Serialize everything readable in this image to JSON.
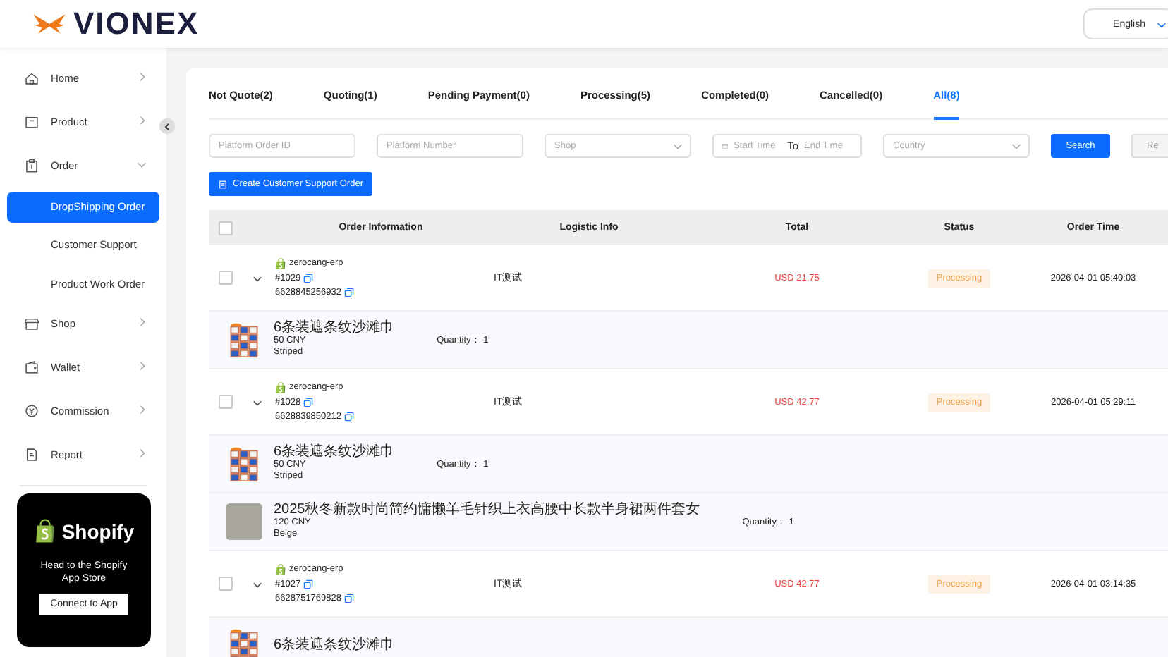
{
  "header": {
    "logo_text": "VIONEX",
    "language": "English"
  },
  "sidebar": {
    "items": [
      {
        "label": "Home",
        "expanded": false
      },
      {
        "label": "Product",
        "expanded": false
      },
      {
        "label": "Order",
        "expanded": true,
        "children": [
          {
            "label": "DropShipping Order",
            "selected": true
          },
          {
            "label": "Customer Support",
            "selected": false
          },
          {
            "label": "Product Work Order",
            "selected": false
          }
        ]
      },
      {
        "label": "Shop",
        "expanded": false
      },
      {
        "label": "Wallet",
        "expanded": false
      },
      {
        "label": "Commission",
        "expanded": false
      },
      {
        "label": "Report",
        "expanded": false
      }
    ]
  },
  "promo": {
    "brand": "Shopify",
    "text": "Head to the Shopify App Store",
    "button": "Connect to App"
  },
  "tabs": [
    {
      "label": "Not Quote(2)",
      "selected": false
    },
    {
      "label": "Quoting(1)",
      "selected": false
    },
    {
      "label": "Pending Payment(0)",
      "selected": false
    },
    {
      "label": "Processing(5)",
      "selected": false
    },
    {
      "label": "Completed(0)",
      "selected": false
    },
    {
      "label": "Cancelled(0)",
      "selected": false
    },
    {
      "label": "All(8)",
      "selected": true
    }
  ],
  "filters": {
    "platform_order_id": {
      "placeholder": "Platform Order ID"
    },
    "platform_number": {
      "placeholder": "Platform Number"
    },
    "shop": {
      "placeholder": "Shop"
    },
    "start_time": {
      "placeholder": "Start Time"
    },
    "date_separator": "To",
    "end_time": {
      "placeholder": "End Time"
    },
    "country": {
      "placeholder": "Country"
    },
    "search_button": "Search",
    "reset_button": "Re"
  },
  "create_button": "Create Customer Support Order",
  "table": {
    "columns": [
      "Order Information",
      "Logistic Info",
      "Total",
      "Status",
      "Order Time"
    ],
    "select_all": false,
    "orders": [
      {
        "checked": false,
        "expanded": true,
        "shop": "zerocang-erp",
        "order_no": "#1029",
        "platform_no": "6628845256932",
        "logistic": "IT测试",
        "total": "USD 21.75",
        "status": "Processing",
        "time": "2026-04-01 05:40:03",
        "items": [
          {
            "kind": "towel",
            "name": "6条装遮条纹沙滩巾",
            "price": "50 CNY",
            "variant": "Striped",
            "quantity_label": "Quantity：",
            "quantity": "1"
          }
        ]
      },
      {
        "checked": false,
        "expanded": true,
        "shop": "zerocang-erp",
        "order_no": "#1028",
        "platform_no": "6628839850212",
        "logistic": "IT测试",
        "total": "USD 42.77",
        "status": "Processing",
        "time": "2026-04-01 05:29:11",
        "items": [
          {
            "kind": "towel",
            "name": "6条装遮条纹沙滩巾",
            "price": "50 CNY",
            "variant": "Striped",
            "quantity_label": "Quantity：",
            "quantity": "1"
          },
          {
            "kind": "photo",
            "name": "2025秋冬新款时尚简约慵懒羊毛针织上衣高腰中长款半身裙两件套女",
            "price": "120 CNY",
            "variant": "Beige",
            "quantity_label": "Quantity：",
            "quantity": "1"
          }
        ]
      },
      {
        "checked": false,
        "expanded": true,
        "shop": "zerocang-erp",
        "order_no": "#1027",
        "platform_no": "6628751769828",
        "logistic": "IT测试",
        "total": "USD 42.77",
        "status": "Processing",
        "time": "2026-04-01 03:14:35",
        "items": [
          {
            "kind": "towel",
            "name": "6条装遮条纹沙滩巾"
          }
        ]
      }
    ]
  }
}
